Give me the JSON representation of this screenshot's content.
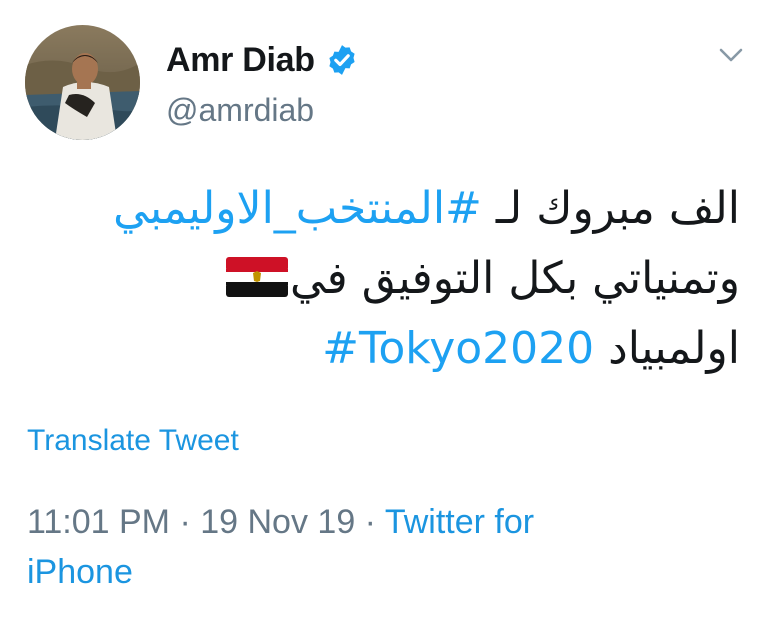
{
  "user": {
    "display_name": "Amr Diab",
    "handle": "@amrdiab",
    "verified_icon": "verified-badge-icon",
    "avatar": "profile-photo"
  },
  "tweet": {
    "line1_text": "الف مبروك لـ ",
    "line1_hashtag": "#المنتخب_الاوليمبي",
    "line2_text": "وتمنياتي بكل التوفيق في",
    "line2_flag": "egypt-flag-icon",
    "line3_text": "اولمبياد ",
    "line3_hashtag": "#Tokyo2020"
  },
  "actions": {
    "translate": "Translate Tweet",
    "menu_icon": "chevron-down-icon"
  },
  "meta": {
    "time": "11:01 PM",
    "sep1": " · ",
    "date": "19 Nov 19",
    "sep2": " · ",
    "source_part1": "Twitter for",
    "source_part2": "iPhone"
  },
  "colors": {
    "link": "#1b95e0",
    "hashtag": "#1da1f2",
    "text": "#14171a",
    "muted": "#657786"
  }
}
